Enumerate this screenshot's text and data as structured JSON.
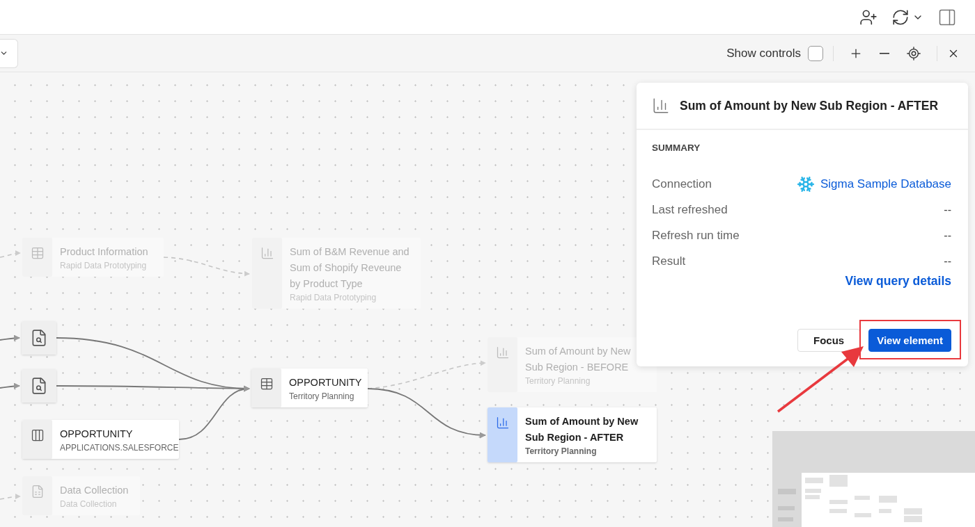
{
  "toolbar": {
    "show_controls": {
      "label": "Show controls",
      "checked": false
    }
  },
  "nodes": [
    {
      "kind": "table",
      "title": "Product Information",
      "subtitle": "Rapid Data Prototyping",
      "dimmed": true,
      "selected": false
    },
    {
      "kind": "chart",
      "title": "Sum of B&M Revenue and Sum of Shopify Reveune by Product Type",
      "subtitle": "Rapid Data Prototyping",
      "dimmed": true,
      "selected": false
    },
    {
      "kind": "search",
      "dimmed": false,
      "selected": false
    },
    {
      "kind": "search",
      "dimmed": false,
      "selected": false
    },
    {
      "kind": "table",
      "title": "OPPORTUNITY",
      "subtitle": "Territory Planning",
      "dimmed": false,
      "selected": false
    },
    {
      "kind": "source",
      "title": "OPPORTUNITY",
      "subtitle": "APPLICATIONS.SALESFORCE",
      "dimmed": false,
      "selected": false
    },
    {
      "kind": "dataset",
      "title": "Data Collection",
      "subtitle": "Data Collection",
      "dimmed": true,
      "selected": false
    },
    {
      "kind": "chart",
      "title": "Sum of Amount by New Sub Region - BEFORE",
      "subtitle": "Territory Planning",
      "dimmed": true,
      "selected": false
    },
    {
      "kind": "chart",
      "title": "Sum of Amount by New Sub Region - AFTER",
      "subtitle": "Territory Planning",
      "dimmed": false,
      "selected": true
    }
  ],
  "edges": [
    {
      "dashed": true
    },
    {
      "dashed": true
    },
    {
      "dashed": false
    },
    {
      "dashed": false
    },
    {
      "dashed": false
    },
    {
      "dashed": false
    },
    {
      "dashed": false
    },
    {
      "dashed": true
    },
    {
      "dashed": false
    },
    {
      "dashed": true
    }
  ],
  "panel": {
    "title": "Sum of Amount by New Sub Region - AFTER",
    "section": "SUMMARY",
    "rows": [
      {
        "kind": "link",
        "label": "Connection",
        "value": "Sigma Sample Database"
      },
      {
        "kind": "text",
        "label": "Last refreshed",
        "value": "--"
      },
      {
        "kind": "text",
        "label": "Refresh run time",
        "value": "--"
      },
      {
        "kind": "text",
        "label": "Result",
        "value": "--"
      }
    ],
    "link": "View query details",
    "buttons": [
      {
        "label": "Focus",
        "kind": "secondary"
      },
      {
        "label": "View element",
        "kind": "primary"
      }
    ]
  }
}
